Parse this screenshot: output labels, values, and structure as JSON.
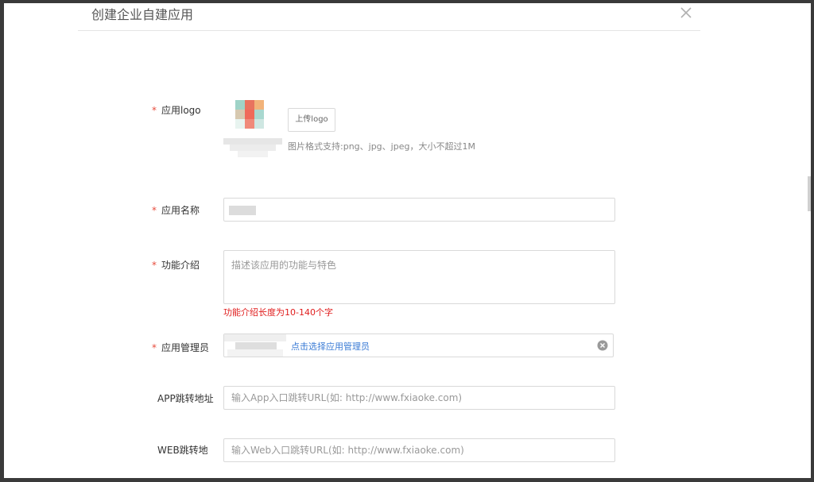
{
  "dialog": {
    "title": "创建企业自建应用",
    "close_icon": "close-icon"
  },
  "form": {
    "required_mark": "*",
    "logo": {
      "label": "应用logo",
      "upload_label": "上传logo",
      "hint": "图片格式支持:png、jpg、jpeg，大小不超过1M"
    },
    "app_name": {
      "label": "应用名称",
      "value": ""
    },
    "description": {
      "label": "功能介绍",
      "placeholder": "描述该应用的功能与特色",
      "error": "功能介绍长度为10-140个字"
    },
    "admin": {
      "label": "应用管理员",
      "link_text": "点击选择应用管理员",
      "clear_icon": "clear-circle-icon"
    },
    "app_url": {
      "label": "APP跳转地址",
      "placeholder": "输入App入口跳转URL(如: http://www.fxiaoke.com)"
    },
    "web_url": {
      "label": "WEB跳转地",
      "placeholder": "输入Web入口跳转URL(如: http://www.fxiaoke.com)"
    }
  },
  "colors": {
    "required": "#e74c3c",
    "error": "#e01d1d",
    "link": "#3a7bd5",
    "border": "#d9d9d9"
  }
}
